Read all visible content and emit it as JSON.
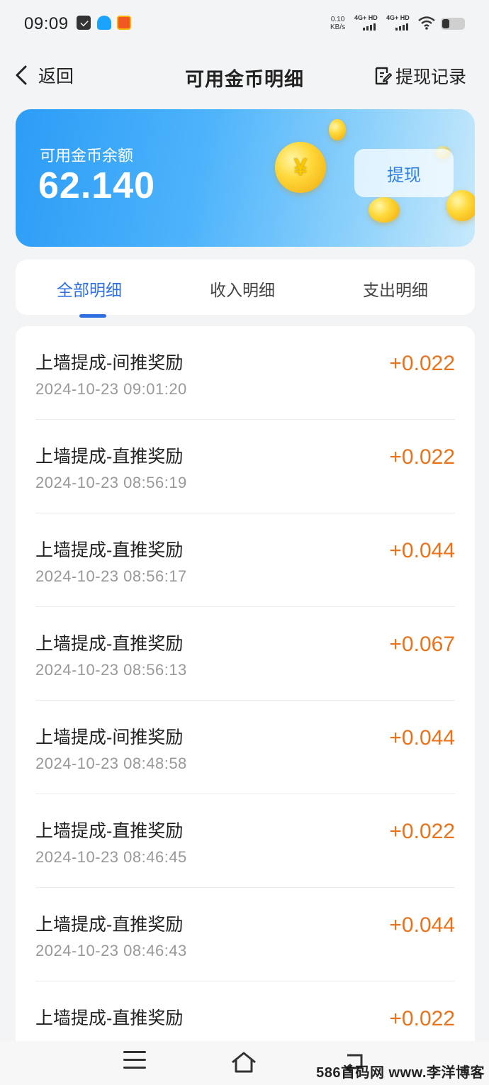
{
  "status_bar": {
    "time": "09:09",
    "net_speed_value": "0.10",
    "net_speed_unit": "KB/s",
    "signal1_label": "4G+ HD",
    "signal2_label": "4G+ HD",
    "icons": [
      "mail-icon",
      "bell-icon",
      "app-badge-icon",
      "wifi-icon",
      "battery-icon"
    ]
  },
  "nav": {
    "back_label": "返回",
    "title": "可用金币明细",
    "records_label": "提现记录"
  },
  "balance": {
    "label": "可用金币余额",
    "value": "62.140",
    "withdraw_label": "提现",
    "coin_symbol": "¥"
  },
  "tabs": [
    {
      "label": "全部明细",
      "active": true
    },
    {
      "label": "收入明细",
      "active": false
    },
    {
      "label": "支出明细",
      "active": false
    }
  ],
  "transactions": [
    {
      "title": "上墙提成-间推奖励",
      "time": "2024-10-23 09:01:20",
      "amount": "+0.022"
    },
    {
      "title": "上墙提成-直推奖励",
      "time": "2024-10-23 08:56:19",
      "amount": "+0.022"
    },
    {
      "title": "上墙提成-直推奖励",
      "time": "2024-10-23 08:56:17",
      "amount": "+0.044"
    },
    {
      "title": "上墙提成-直推奖励",
      "time": "2024-10-23 08:56:13",
      "amount": "+0.067"
    },
    {
      "title": "上墙提成-间推奖励",
      "time": "2024-10-23 08:48:58",
      "amount": "+0.044"
    },
    {
      "title": "上墙提成-直推奖励",
      "time": "2024-10-23 08:46:45",
      "amount": "+0.022"
    },
    {
      "title": "上墙提成-直推奖励",
      "time": "2024-10-23 08:46:43",
      "amount": "+0.044"
    },
    {
      "title": "上墙提成-直推奖励",
      "time": "",
      "amount": "+0.022"
    }
  ],
  "watermark": "586首码网 www.李洋博客",
  "colors": {
    "accent": "#2f6fe0",
    "amount": "#e8731c",
    "card_start": "#2c9cf6",
    "card_end": "#c8e9fb"
  }
}
